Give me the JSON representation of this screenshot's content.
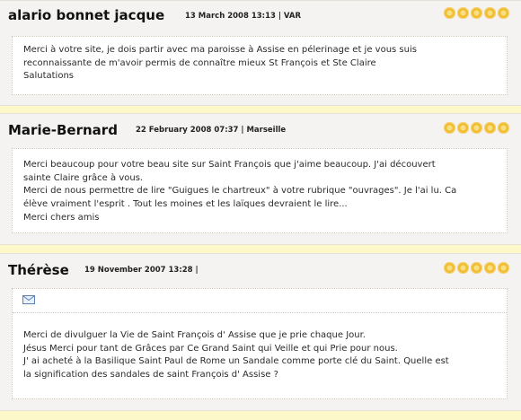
{
  "entries": [
    {
      "author": "alario bonnet jacque",
      "meta": "13 March 2008 13:13 | VAR",
      "rating": 5,
      "lines": [
        "Merci à votre site, je dois partir avec ma paroisse à Assise en pélerinage et je vous suis",
        "reconnaissante de m'avoir permis de connaître mieux St François et Ste Claire",
        "Salutations"
      ]
    },
    {
      "author": "Marie-Bernard",
      "meta": "22 February 2008 07:37 | Marseille",
      "rating": 5,
      "lines": [
        "Merci beaucoup pour votre beau site sur Saint François que j'aime beaucoup. J'ai découvert",
        "sainte Claire grâce à vous.",
        "Merci de nous permettre de lire \"Guigues le chartreux\" à votre rubrique \"ouvrages\". Je l'ai lu. Ca",
        "élève vraiment l'esprit . Tout les moines et les laïques devraient le lire...",
        "Merci chers amis"
      ]
    },
    {
      "author": "Thérèse",
      "meta": "19 November 2007 13:28 |",
      "rating": 5,
      "icon": "envelope-icon",
      "lines": [
        "Merci de divulguer la Vie de Saint François d' Assise que je prie chaque Jour.",
        "Jésus Merci pour tant de Grâces par Ce Grand Saint qui Veille et qui Prie pour nous.",
        "J' ai acheté à la Basilique Saint Paul de Rome un Sandale comme porte clé du Saint. Quelle est",
        "la signification des sandales de saint François d' Assise ?"
      ]
    }
  ],
  "colors": {
    "page_bg": "#fdf8c9",
    "entry_bg": "#f4f3f1",
    "star": "#f1bd32"
  }
}
